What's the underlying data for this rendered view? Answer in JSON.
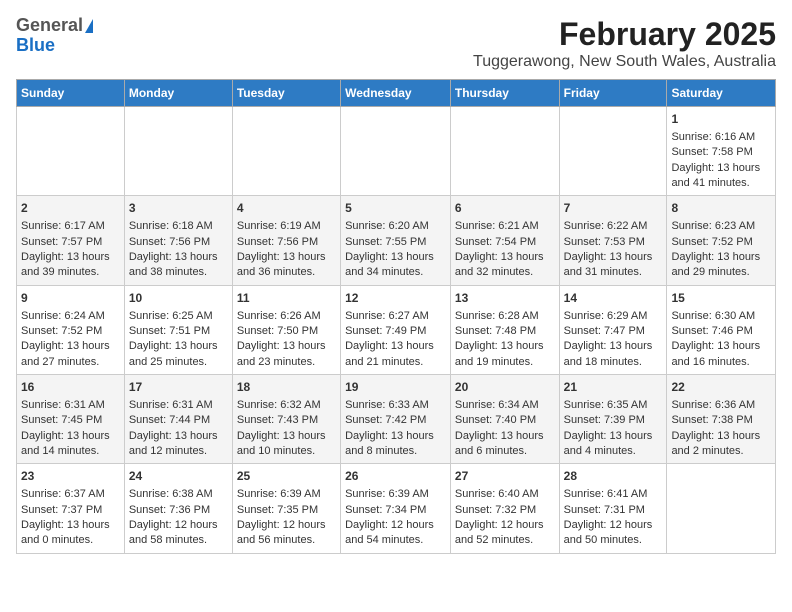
{
  "header": {
    "logo_general": "General",
    "logo_blue": "Blue",
    "title": "February 2025",
    "subtitle": "Tuggerawong, New South Wales, Australia"
  },
  "columns": [
    "Sunday",
    "Monday",
    "Tuesday",
    "Wednesday",
    "Thursday",
    "Friday",
    "Saturday"
  ],
  "weeks": [
    [
      {
        "day": "",
        "info": ""
      },
      {
        "day": "",
        "info": ""
      },
      {
        "day": "",
        "info": ""
      },
      {
        "day": "",
        "info": ""
      },
      {
        "day": "",
        "info": ""
      },
      {
        "day": "",
        "info": ""
      },
      {
        "day": "1",
        "info": "Sunrise: 6:16 AM\nSunset: 7:58 PM\nDaylight: 13 hours\nand 41 minutes."
      }
    ],
    [
      {
        "day": "2",
        "info": "Sunrise: 6:17 AM\nSunset: 7:57 PM\nDaylight: 13 hours\nand 39 minutes."
      },
      {
        "day": "3",
        "info": "Sunrise: 6:18 AM\nSunset: 7:56 PM\nDaylight: 13 hours\nand 38 minutes."
      },
      {
        "day": "4",
        "info": "Sunrise: 6:19 AM\nSunset: 7:56 PM\nDaylight: 13 hours\nand 36 minutes."
      },
      {
        "day": "5",
        "info": "Sunrise: 6:20 AM\nSunset: 7:55 PM\nDaylight: 13 hours\nand 34 minutes."
      },
      {
        "day": "6",
        "info": "Sunrise: 6:21 AM\nSunset: 7:54 PM\nDaylight: 13 hours\nand 32 minutes."
      },
      {
        "day": "7",
        "info": "Sunrise: 6:22 AM\nSunset: 7:53 PM\nDaylight: 13 hours\nand 31 minutes."
      },
      {
        "day": "8",
        "info": "Sunrise: 6:23 AM\nSunset: 7:52 PM\nDaylight: 13 hours\nand 29 minutes."
      }
    ],
    [
      {
        "day": "9",
        "info": "Sunrise: 6:24 AM\nSunset: 7:52 PM\nDaylight: 13 hours\nand 27 minutes."
      },
      {
        "day": "10",
        "info": "Sunrise: 6:25 AM\nSunset: 7:51 PM\nDaylight: 13 hours\nand 25 minutes."
      },
      {
        "day": "11",
        "info": "Sunrise: 6:26 AM\nSunset: 7:50 PM\nDaylight: 13 hours\nand 23 minutes."
      },
      {
        "day": "12",
        "info": "Sunrise: 6:27 AM\nSunset: 7:49 PM\nDaylight: 13 hours\nand 21 minutes."
      },
      {
        "day": "13",
        "info": "Sunrise: 6:28 AM\nSunset: 7:48 PM\nDaylight: 13 hours\nand 19 minutes."
      },
      {
        "day": "14",
        "info": "Sunrise: 6:29 AM\nSunset: 7:47 PM\nDaylight: 13 hours\nand 18 minutes."
      },
      {
        "day": "15",
        "info": "Sunrise: 6:30 AM\nSunset: 7:46 PM\nDaylight: 13 hours\nand 16 minutes."
      }
    ],
    [
      {
        "day": "16",
        "info": "Sunrise: 6:31 AM\nSunset: 7:45 PM\nDaylight: 13 hours\nand 14 minutes."
      },
      {
        "day": "17",
        "info": "Sunrise: 6:31 AM\nSunset: 7:44 PM\nDaylight: 13 hours\nand 12 minutes."
      },
      {
        "day": "18",
        "info": "Sunrise: 6:32 AM\nSunset: 7:43 PM\nDaylight: 13 hours\nand 10 minutes."
      },
      {
        "day": "19",
        "info": "Sunrise: 6:33 AM\nSunset: 7:42 PM\nDaylight: 13 hours\nand 8 minutes."
      },
      {
        "day": "20",
        "info": "Sunrise: 6:34 AM\nSunset: 7:40 PM\nDaylight: 13 hours\nand 6 minutes."
      },
      {
        "day": "21",
        "info": "Sunrise: 6:35 AM\nSunset: 7:39 PM\nDaylight: 13 hours\nand 4 minutes."
      },
      {
        "day": "22",
        "info": "Sunrise: 6:36 AM\nSunset: 7:38 PM\nDaylight: 13 hours\nand 2 minutes."
      }
    ],
    [
      {
        "day": "23",
        "info": "Sunrise: 6:37 AM\nSunset: 7:37 PM\nDaylight: 13 hours\nand 0 minutes."
      },
      {
        "day": "24",
        "info": "Sunrise: 6:38 AM\nSunset: 7:36 PM\nDaylight: 12 hours\nand 58 minutes."
      },
      {
        "day": "25",
        "info": "Sunrise: 6:39 AM\nSunset: 7:35 PM\nDaylight: 12 hours\nand 56 minutes."
      },
      {
        "day": "26",
        "info": "Sunrise: 6:39 AM\nSunset: 7:34 PM\nDaylight: 12 hours\nand 54 minutes."
      },
      {
        "day": "27",
        "info": "Sunrise: 6:40 AM\nSunset: 7:32 PM\nDaylight: 12 hours\nand 52 minutes."
      },
      {
        "day": "28",
        "info": "Sunrise: 6:41 AM\nSunset: 7:31 PM\nDaylight: 12 hours\nand 50 minutes."
      },
      {
        "day": "",
        "info": ""
      }
    ]
  ]
}
